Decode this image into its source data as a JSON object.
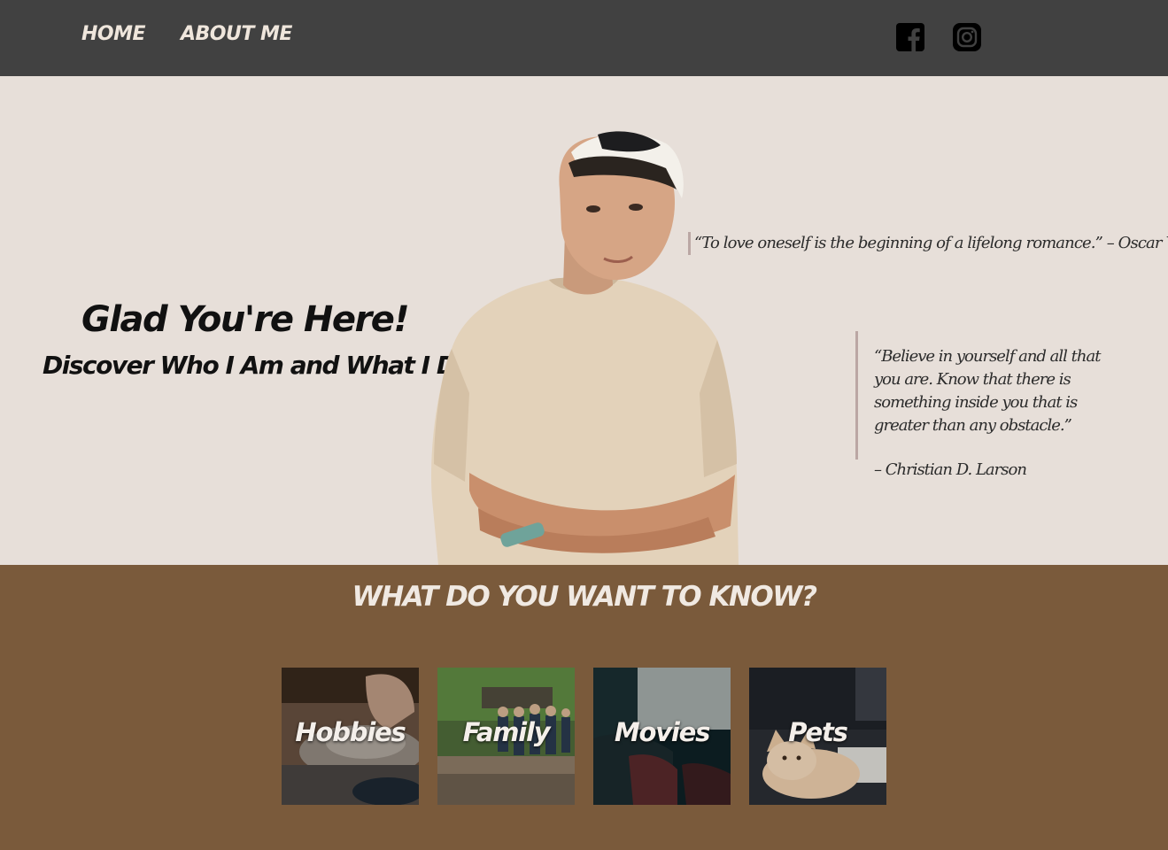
{
  "nav": {
    "links": [
      {
        "label": "HOME"
      },
      {
        "label": "ABOUT ME"
      }
    ],
    "social": [
      {
        "icon": "facebook-icon"
      },
      {
        "icon": "instagram-icon"
      }
    ]
  },
  "hero": {
    "title": "Glad You're Here!",
    "subtitle": "Discover Who I Am and What I Do",
    "quotes": [
      {
        "text": "“To love oneself is the beginning of a lifelong romance.” – Oscar Wilde"
      },
      {
        "text": "“Believe in yourself and all that you are. Know that there is something inside you that is greater than any obstacle.”",
        "author": "– Christian D. Larson"
      }
    ]
  },
  "know": {
    "title": "WHAT DO YOU WANT TO KNOW?",
    "cards": [
      {
        "label": "Hobbies"
      },
      {
        "label": "Family"
      },
      {
        "label": "Movies"
      },
      {
        "label": "Pets"
      }
    ]
  },
  "colors": {
    "nav_bg": "#414141",
    "hero_bg": "#e7dfd9",
    "section_bg": "#7a5a3b",
    "quote_bar": "#bba7a4"
  }
}
